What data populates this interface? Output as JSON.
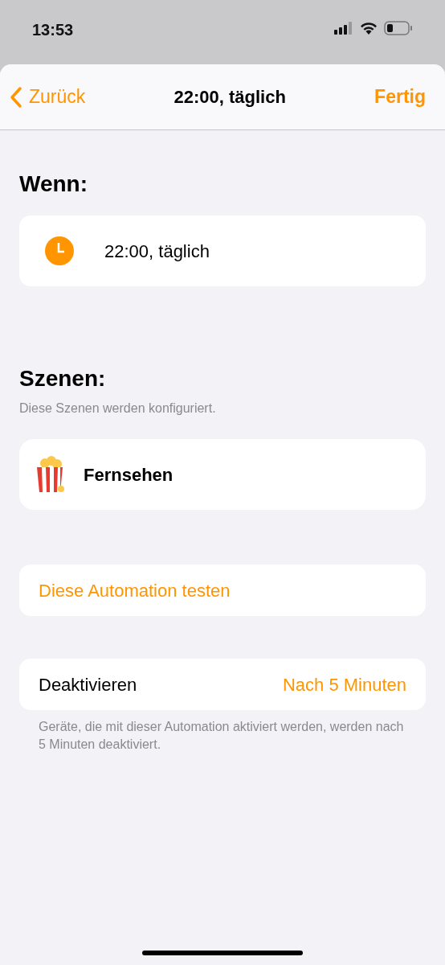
{
  "status_bar": {
    "time": "13:53"
  },
  "nav": {
    "back": "Zurück",
    "title": "22:00, täglich",
    "done": "Fertig"
  },
  "trigger": {
    "heading": "Wenn:",
    "label": "22:00, täglich"
  },
  "scenes": {
    "heading": "Szenen:",
    "subtitle": "Diese Szenen werden konfiguriert.",
    "items": [
      {
        "name": "Fernsehen"
      }
    ]
  },
  "test_button": "Diese Automation testen",
  "deactivate": {
    "label": "Deaktivieren",
    "value": "Nach 5 Minuten",
    "footnote": "Geräte, die mit dieser Automation aktiviert werden, werden nach 5 Minuten deaktiviert."
  }
}
